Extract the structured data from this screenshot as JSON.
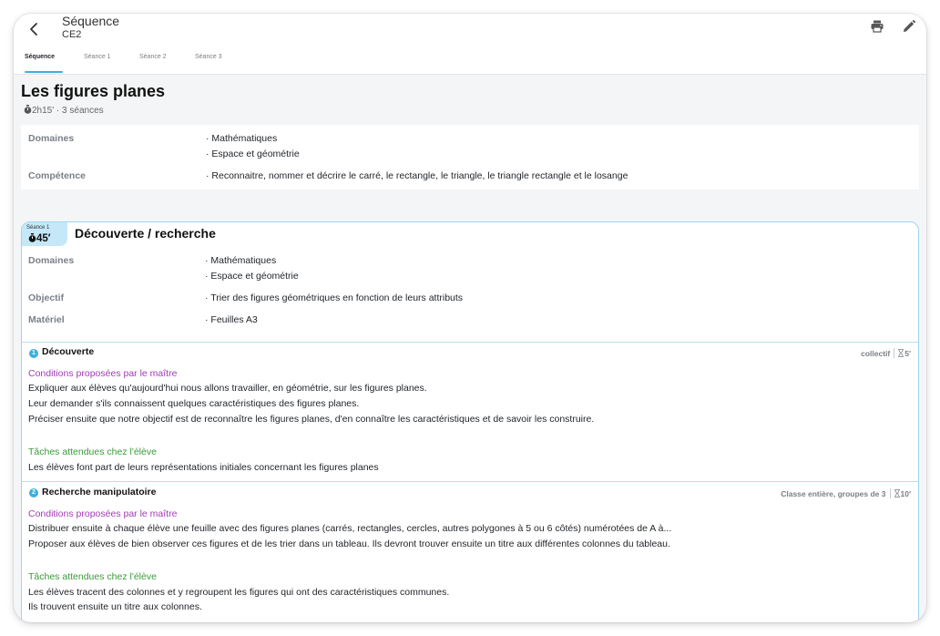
{
  "header": {
    "title": "Séquence",
    "subtitle": "CE2",
    "back_icon": "chevron-left-icon",
    "print_icon": "printer-icon",
    "edit_icon": "pencil-icon"
  },
  "tabs": [
    {
      "label": "Séquence",
      "active": true
    },
    {
      "label": "Séance 1",
      "active": false
    },
    {
      "label": "Séance 2",
      "active": false
    },
    {
      "label": "Séance 3",
      "active": false
    }
  ],
  "sequence": {
    "title": "Les figures planes",
    "meta": "2h15' · 3 séances",
    "domaines_label": "Domaines",
    "domaines": [
      "· Mathématiques",
      "· Espace et géométrie"
    ],
    "competence_label": "Compétence",
    "competence": "· Reconnaitre, nommer et décrire le carré, le rectangle, le triangle, le triangle rectangle et le losange"
  },
  "seance1": {
    "badge_label": "Séance 1",
    "duration": "45′",
    "title": "Découverte / recherche",
    "domaines_label": "Domaines",
    "domaines": [
      "· Mathématiques",
      "· Espace et géométrie"
    ],
    "objectif_label": "Objectif",
    "objectif": "· Trier des figures géométriques en fonction de leurs attributs",
    "materiel_label": "Matériel",
    "materiel": "· Feuilles A3",
    "phases": [
      {
        "num": "1",
        "title": "Découverte",
        "organisation": "collectif",
        "duration": "5′",
        "conditions_label": "Conditions proposées par le maître",
        "conditions": [
          "Expliquer aux élèves qu'aujourd'hui nous allons travailler, en géométrie, sur les figures planes.",
          "Leur demander s'ils connaissent quelques caractéristiques des figures planes.",
          "Préciser ensuite que notre objectif est de reconnaître les figures planes, d'en connaître les caractéristiques et de savoir les construire."
        ],
        "taches_label": "Tâches attendues chez l'élève",
        "taches": [
          "Les élèves font part de leurs représentations initiales concernant les figures planes"
        ]
      },
      {
        "num": "2",
        "title": "Recherche manipulatoire",
        "organisation": "Classe entière, groupes de 3",
        "duration": "10′",
        "conditions_label": "Conditions proposées par le maître",
        "conditions": [
          "Distribuer ensuite à chaque élève une feuille avec des figures planes (carrés, rectangles, cercles, autres polygones à 5 ou 6 côtés) numérotées de A à...",
          "Proposer aux élèves de bien observer ces figures et de les trier dans un tableau. Ils devront trouver ensuite un titre aux différentes colonnes du tableau."
        ],
        "taches_label": "Tâches attendues chez l'élève",
        "taches": [
          "Les élèves tracent des colonnes et y regroupent les figures qui ont des caractéristiques communes.",
          "Ils trouvent ensuite un titre aux colonnes."
        ]
      }
    ]
  },
  "colors": {
    "accent": "#3ab0df",
    "badge_bg": "#c4e8f8",
    "conditions": "#a23bb5",
    "taches": "#3a9a3a"
  }
}
